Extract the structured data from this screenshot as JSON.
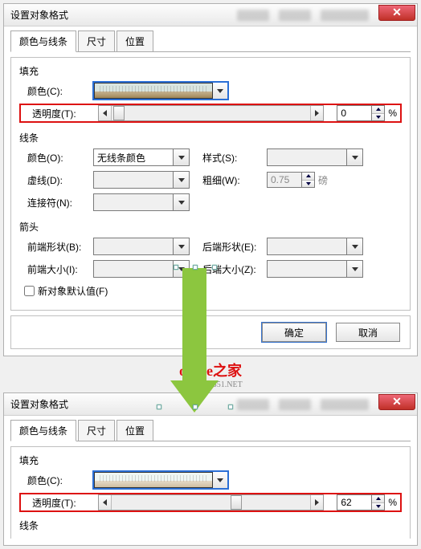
{
  "dialog_title": "设置对象格式",
  "tabs": {
    "tab1": "颜色与线条",
    "tab2": "尺寸",
    "tab3": "位置"
  },
  "fill": {
    "header": "填充",
    "color_label": "颜色(C):",
    "transparency_label": "透明度(T):",
    "transparency_value_top": "0",
    "transparency_value_bottom": "62",
    "percent": "%"
  },
  "line": {
    "header": "线条",
    "color_label": "颜色(O):",
    "color_value": "无线条颜色",
    "style_label": "样式(S):",
    "dash_label": "虚线(D):",
    "weight_label": "粗细(W):",
    "weight_value": "0.75",
    "weight_unit": "磅",
    "connector_label": "连接符(N):"
  },
  "arrow": {
    "header": "箭头",
    "begin_shape": "前端形状(B):",
    "end_shape": "后端形状(E):",
    "begin_size": "前端大小(I):",
    "end_size": "后端大小(Z):"
  },
  "defaults_label": "新对象默认值(F)",
  "buttons": {
    "ok": "确定",
    "cancel": "取消"
  },
  "watermark": {
    "main": "office之家",
    "sub": "OFFICE.JB51.NET"
  }
}
